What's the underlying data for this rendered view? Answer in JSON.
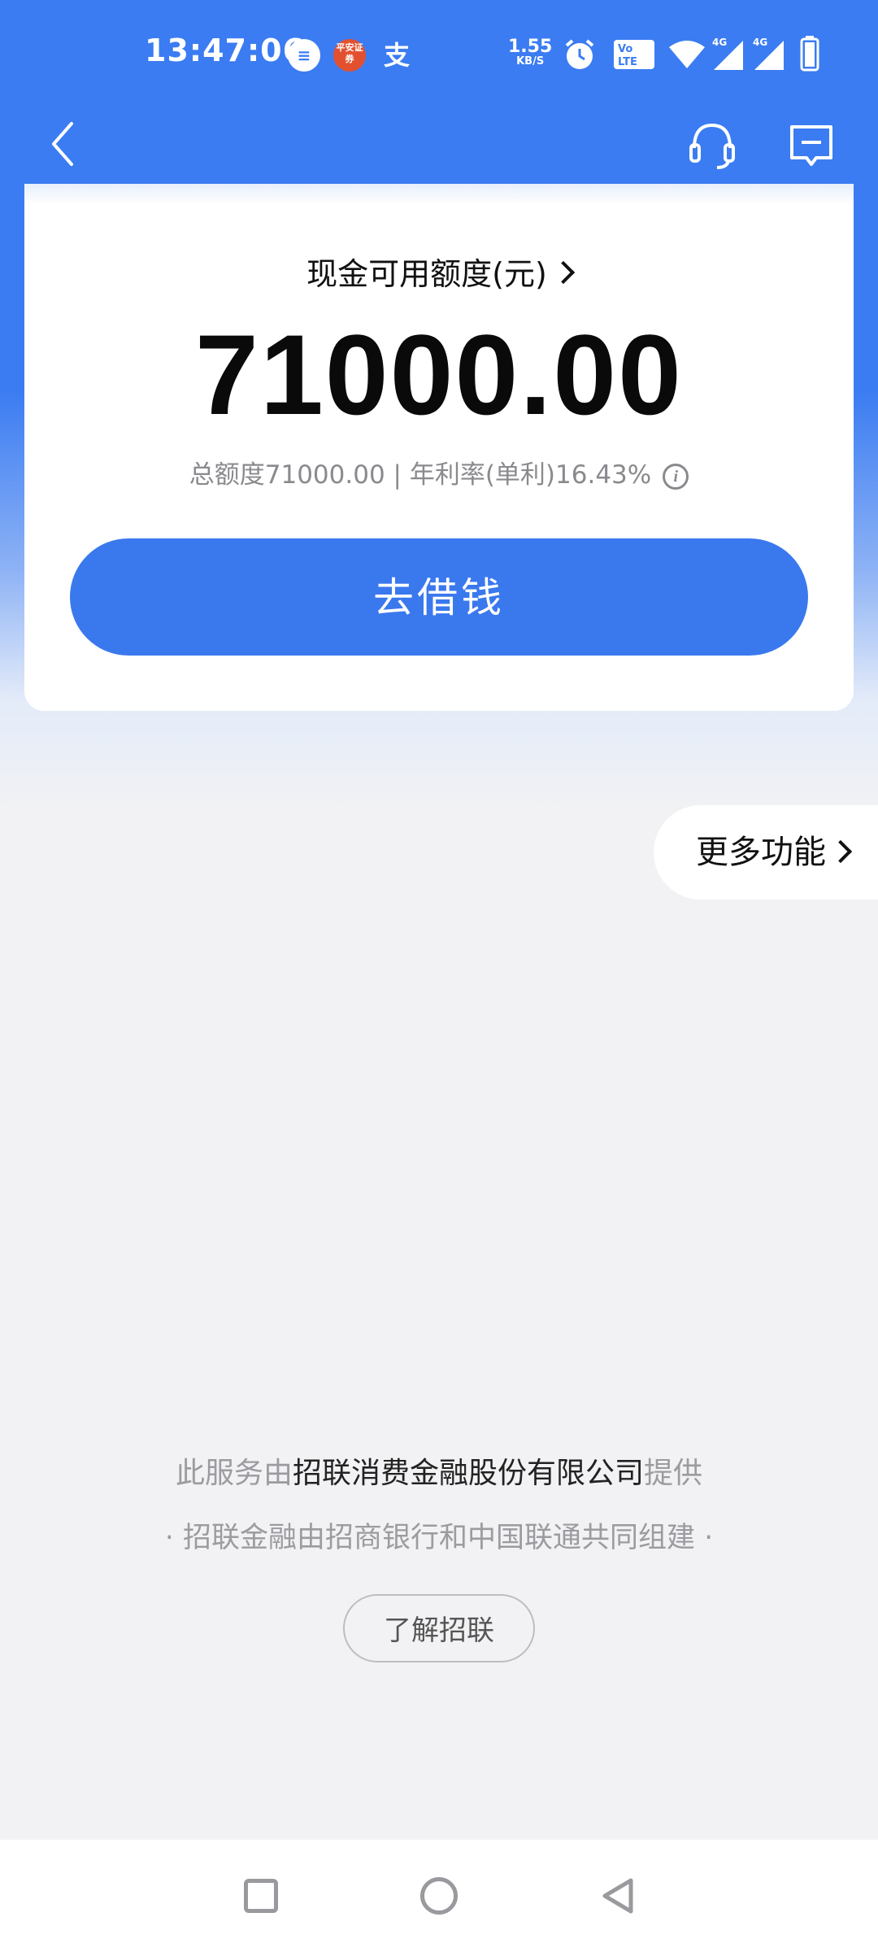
{
  "status_bar": {
    "time": "13:47:06",
    "net_speed": "1.55",
    "net_speed_unit": "KB/S",
    "pingan_badge": "平安证券",
    "alipay_badge": "支",
    "icons": [
      "message-bubble-icon",
      "pingan-securities-icon",
      "alipay-icon",
      "alarm-icon",
      "volte-icon",
      "wifi-icon",
      "signal-4g-icon",
      "signal-4g-icon",
      "battery-icon"
    ]
  },
  "nav": {
    "back_icon": "chevron-left-icon",
    "service_icon": "headset-icon",
    "message_icon": "message-icon"
  },
  "credit_card": {
    "label": "现金可用额度(元)",
    "amount": "71000.00",
    "info_text": "总额度71000.00 | 年利率(单利)16.43%",
    "borrow_button": "去借钱"
  },
  "more_functions": {
    "label": "更多功能"
  },
  "footer": {
    "line1_prefix": "此服务由",
    "line1_company": "招联消费金融股份有限公司",
    "line1_suffix": "提供",
    "line2": "· 招联金融由招商银行和中国联通共同组建 ·",
    "learn_button": "了解招联"
  },
  "colors": {
    "primary": "#3a78ee",
    "background": "#f2f2f4"
  }
}
